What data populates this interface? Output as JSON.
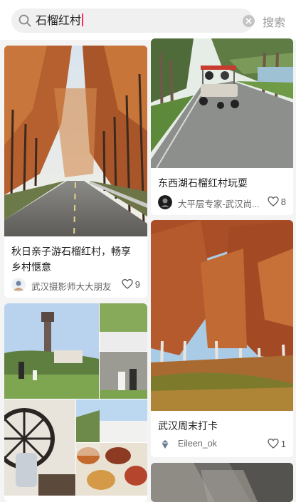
{
  "search": {
    "query": "石榴红村",
    "button_label": "搜索"
  },
  "cards": [
    {
      "title": "秋日亲子游石榴红村，畅享乡村惬意",
      "title_line1": "秋日亲子游石榴红村，畅享",
      "title_line2": "乡村惬意",
      "author": "武汉摄影师大大朋友",
      "likes": "9"
    },
    {
      "title": "东西湖石榴红村玩耍",
      "author": "大平层专家-武汉尚...",
      "likes": "8"
    },
    {
      "title": "武汉周末打卡",
      "author": "Eileen_ok",
      "likes": "1"
    }
  ],
  "colors": {
    "accent_caret": "#ff2d55",
    "search_bg": "#f0f0f0",
    "page_bg": "#f4f4f4"
  },
  "icons": [
    "search-icon",
    "clear-icon",
    "heart-icon"
  ]
}
